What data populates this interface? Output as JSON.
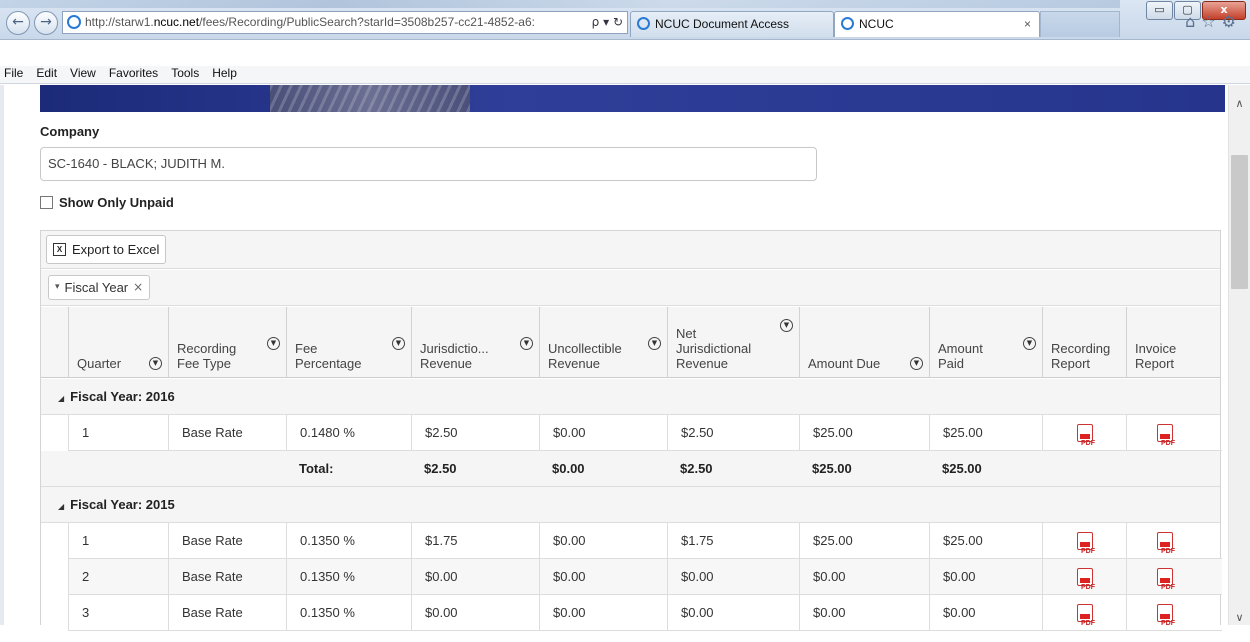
{
  "browser": {
    "url_prefix": "http://starw1.",
    "url_host": "ncuc.net",
    "url_rest": "/fees/Recording/PublicSearch?starId=3508b257-cc21-4852-a6:",
    "addr_tools": "ρ ▾ ↻",
    "tabs": [
      {
        "label": "NCUC Document Access"
      },
      {
        "label": "NCUC",
        "close": "×"
      }
    ],
    "window_controls": {
      "minimize": "▭",
      "maximize": "▢",
      "close": "x"
    }
  },
  "menu": [
    "File",
    "Edit",
    "View",
    "Favorites",
    "Tools",
    "Help"
  ],
  "form": {
    "company_label": "Company",
    "company_value": "SC-1640 - BLACK; JUDITH M.",
    "show_unpaid_label": "Show Only Unpaid"
  },
  "grid": {
    "export_label": "Export to Excel",
    "group_chip": "Fiscal Year",
    "columns": [
      {
        "label": "Quarter"
      },
      {
        "label": "Recording Fee Type"
      },
      {
        "label": "Fee Percentage"
      },
      {
        "label": "Jurisdictio... Revenue"
      },
      {
        "label": "Uncollectible Revenue"
      },
      {
        "label": "Net Jurisdictional Revenue"
      },
      {
        "label": "Amount Due"
      },
      {
        "label": "Amount Paid"
      },
      {
        "label": "Recording Report"
      },
      {
        "label": "Invoice Report"
      }
    ],
    "groups": [
      {
        "title": "Fiscal Year: 2016",
        "rows": [
          {
            "quarter": "1",
            "type": "Base Rate",
            "fee": "0.1480 %",
            "jur": "$2.50",
            "unc": "$0.00",
            "net": "$2.50",
            "due": "$25.00",
            "paid": "$25.00"
          }
        ],
        "total": {
          "label": "Total:",
          "jur": "$2.50",
          "unc": "$0.00",
          "net": "$2.50",
          "due": "$25.00",
          "paid": "$25.00"
        }
      },
      {
        "title": "Fiscal Year: 2015",
        "rows": [
          {
            "quarter": "1",
            "type": "Base Rate",
            "fee": "0.1350 %",
            "jur": "$1.75",
            "unc": "$0.00",
            "net": "$1.75",
            "due": "$25.00",
            "paid": "$25.00"
          },
          {
            "quarter": "2",
            "type": "Base Rate",
            "fee": "0.1350 %",
            "jur": "$0.00",
            "unc": "$0.00",
            "net": "$0.00",
            "due": "$0.00",
            "paid": "$0.00"
          },
          {
            "quarter": "3",
            "type": "Base Rate",
            "fee": "0.1350 %",
            "jur": "$0.00",
            "unc": "$0.00",
            "net": "$0.00",
            "due": "$0.00",
            "paid": "$0.00"
          }
        ]
      }
    ]
  }
}
